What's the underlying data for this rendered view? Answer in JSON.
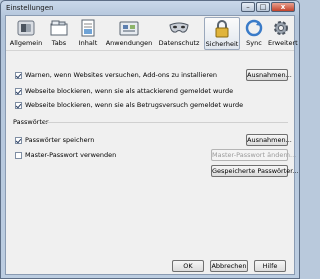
{
  "window": {
    "title": "Einstellungen",
    "controls": {
      "minimize": "–",
      "maximize": "□",
      "close": "x"
    }
  },
  "tabs": [
    {
      "label": "Allgemein",
      "icon": "switch-icon"
    },
    {
      "label": "Tabs",
      "icon": "tabs-icon"
    },
    {
      "label": "Inhalt",
      "icon": "document-icon"
    },
    {
      "label": "Anwendungen",
      "icon": "applications-icon"
    },
    {
      "label": "Datenschutz",
      "icon": "mask-icon"
    },
    {
      "label": "Sicherheit",
      "icon": "lock-icon",
      "active": true
    },
    {
      "label": "Sync",
      "icon": "sync-icon"
    },
    {
      "label": "Erweitert",
      "icon": "gear-icon"
    }
  ],
  "security": {
    "warn_addons": {
      "label": "Warnen, wenn Websites versuchen, Add-ons zu installieren",
      "checked": true
    },
    "block_attack": {
      "label": "Webseite blockieren, wenn sie als attackierend gemeldet wurde",
      "checked": true
    },
    "block_fraud": {
      "label": "Webseite blockieren, wenn sie als Betrugsversuch gemeldet wurde",
      "checked": true
    },
    "exceptions_button": "Ausnahmen..."
  },
  "passwords": {
    "heading": "Passwörter",
    "save_passwords": {
      "label": "Passwörter speichern",
      "checked": true
    },
    "exceptions_button": "Ausnahmen...",
    "master_password": {
      "label": "Master-Passwort verwenden",
      "checked": false
    },
    "change_master_button": "Master-Passwort ändern...",
    "saved_passwords_button": "Gespeicherte Passwörter..."
  },
  "footer": {
    "ok": "OK",
    "cancel": "Abbrechen",
    "help": "Hilfe"
  },
  "colors": {
    "window_frame": "#b9c9dc",
    "client_bg": "#f0f0f0",
    "close_button": "#c4432b"
  }
}
